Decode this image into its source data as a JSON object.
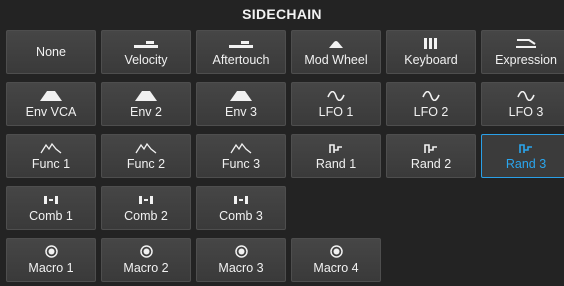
{
  "title": "SIDECHAIN",
  "colors": {
    "background": "#232323",
    "button": "#3f3f3f",
    "selected_accent": "#2aa0e8"
  },
  "buttons": [
    {
      "label": "None",
      "icon": "none"
    },
    {
      "label": "Velocity",
      "icon": "velocity-icon"
    },
    {
      "label": "Aftertouch",
      "icon": "aftertouch-icon"
    },
    {
      "label": "Mod Wheel",
      "icon": "mod-wheel-icon"
    },
    {
      "label": "Keyboard",
      "icon": "keyboard-icon"
    },
    {
      "label": "Expression",
      "icon": "expression-pedal-icon"
    },
    {
      "label": "Env VCA",
      "icon": "envelope-icon"
    },
    {
      "label": "Env 2",
      "icon": "envelope-icon"
    },
    {
      "label": "Env 3",
      "icon": "envelope-icon"
    },
    {
      "label": "LFO 1",
      "icon": "sine-wave-icon"
    },
    {
      "label": "LFO 2",
      "icon": "sine-wave-icon"
    },
    {
      "label": "LFO 3",
      "icon": "sine-wave-icon"
    },
    {
      "label": "Func 1",
      "icon": "function-curve-icon"
    },
    {
      "label": "Func 2",
      "icon": "function-curve-icon"
    },
    {
      "label": "Func 3",
      "icon": "function-curve-icon"
    },
    {
      "label": "Rand 1",
      "icon": "random-steps-icon"
    },
    {
      "label": "Rand 2",
      "icon": "random-steps-icon"
    },
    {
      "label": "Rand 3",
      "icon": "random-steps-icon",
      "selected": true
    },
    {
      "label": "Comb 1",
      "icon": "combinate-icon"
    },
    {
      "label": "Comb 2",
      "icon": "combinate-icon"
    },
    {
      "label": "Comb 3",
      "icon": "combinate-icon"
    },
    {
      "label": "Macro 1",
      "icon": "macro-knob-icon"
    },
    {
      "label": "Macro 2",
      "icon": "macro-knob-icon"
    },
    {
      "label": "Macro 3",
      "icon": "macro-knob-icon"
    },
    {
      "label": "Macro 4",
      "icon": "macro-knob-icon"
    }
  ]
}
